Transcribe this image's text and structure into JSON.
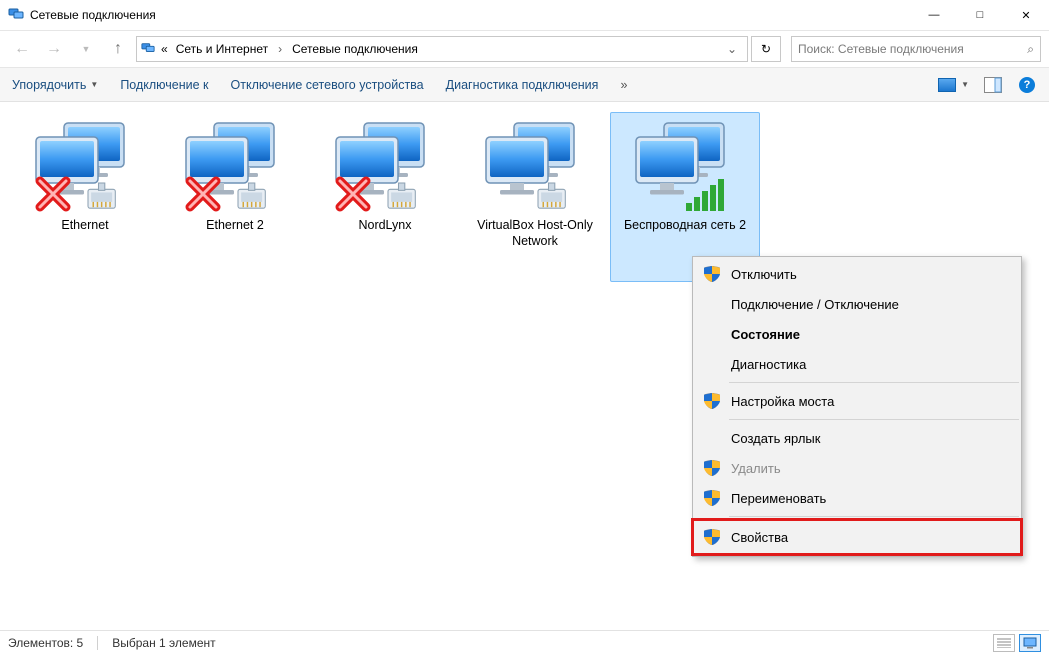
{
  "window": {
    "title": "Сетевые подключения"
  },
  "breadcrumb": {
    "root_prefix": "«",
    "segments": [
      "Сеть и Интернет",
      "Сетевые подключения"
    ]
  },
  "search": {
    "placeholder": "Поиск: Сетевые подключения"
  },
  "commands": {
    "organize": "Упорядочить",
    "connect": "Подключение к",
    "disable": "Отключение сетевого устройства",
    "diagnose": "Диагностика подключения",
    "more": "»"
  },
  "items": [
    {
      "label": "Ethernet",
      "state": "disconnected"
    },
    {
      "label": "Ethernet 2",
      "state": "disconnected"
    },
    {
      "label": "NordLynx",
      "state": "disconnected"
    },
    {
      "label": "VirtualBox Host-Only Network",
      "state": "connected"
    },
    {
      "label": "Беспроводная сеть 2",
      "state": "wifi",
      "selected": true
    }
  ],
  "context_menu": [
    {
      "label": "Отключить",
      "shield": true
    },
    {
      "label": "Подключение / Отключение"
    },
    {
      "label": "Состояние",
      "bold": true
    },
    {
      "label": "Диагностика"
    },
    {
      "sep": true
    },
    {
      "label": "Настройка моста",
      "shield": true
    },
    {
      "sep": true
    },
    {
      "label": "Создать ярлык"
    },
    {
      "label": "Удалить",
      "shield": true,
      "disabled": true
    },
    {
      "label": "Переименовать",
      "shield": true
    },
    {
      "sep": true
    },
    {
      "label": "Свойства",
      "shield": true,
      "highlight": true
    }
  ],
  "status": {
    "count": "Элементов: 5",
    "selection": "Выбран 1 элемент"
  }
}
